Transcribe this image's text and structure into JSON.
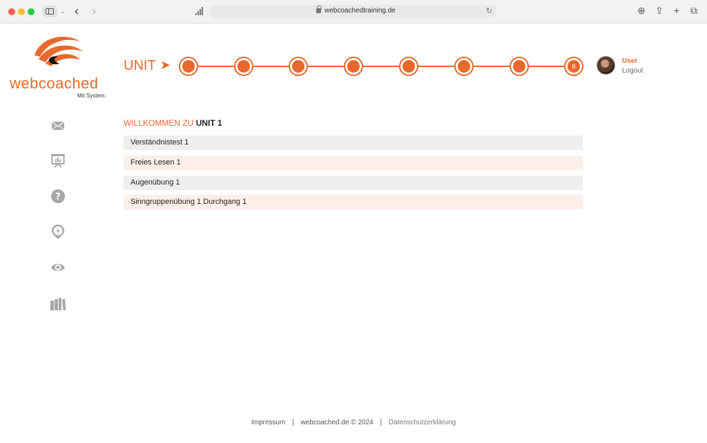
{
  "browser": {
    "url": "webcoachedtraining.de"
  },
  "brand": {
    "name": "webcoached",
    "tagline": "Mit System.",
    "accent": "#e8692b"
  },
  "sidebar": {
    "icons": [
      "mail-icon",
      "presentation-chart-icon",
      "help-icon",
      "lightning-pin-icon",
      "eye-icon",
      "books-icon"
    ]
  },
  "progress": {
    "label": "UNIT",
    "arrow": "➤",
    "current_step_label": "8",
    "steps": 8
  },
  "user": {
    "name": "User",
    "logout": "Logout"
  },
  "main": {
    "welcome_prefix": "WILLKOMMEN ZU",
    "welcome_unit": "UNIT 1",
    "items": [
      "Verständnistest 1",
      "Freies Lesen 1",
      "Augenübung 1",
      "Sinngruppenübung 1 Durchgang 1"
    ]
  },
  "footer": {
    "impressum": "Impressum",
    "separator": "|",
    "copyright": "webcoached.de © 2024",
    "datenschutz": "Datenschutzerklärung"
  }
}
